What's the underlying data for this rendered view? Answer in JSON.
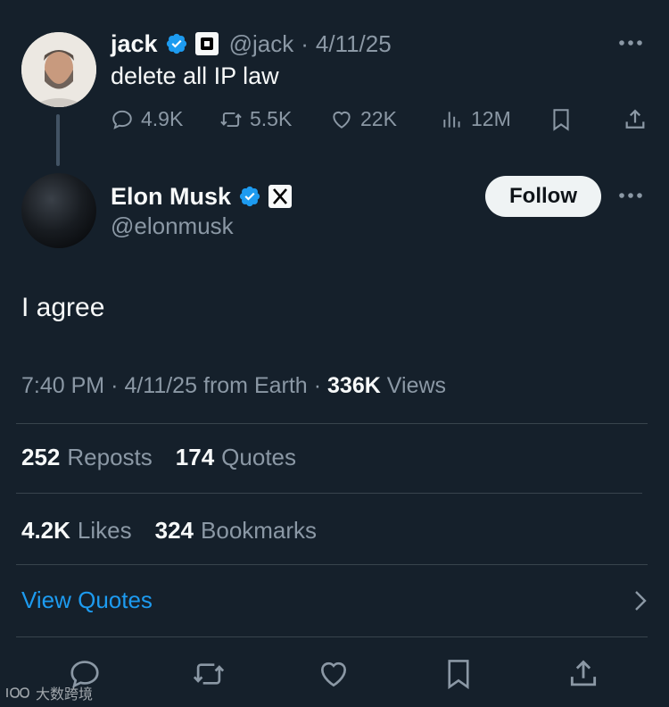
{
  "parent_tweet": {
    "name": "jack",
    "handle": "@jack",
    "separator": "·",
    "date": "4/11/25",
    "text": "delete all IP law",
    "actions": {
      "replies": "4.9K",
      "reposts": "5.5K",
      "likes": "22K",
      "views": "12M"
    }
  },
  "main_tweet": {
    "name": "Elon Musk",
    "handle": "@elonmusk",
    "follow_label": "Follow",
    "text": "I agree",
    "time": "7:40 PM",
    "date": "4/11/25",
    "location": "from Earth",
    "separator": "·",
    "views_count": "336K",
    "views_label": "Views",
    "reposts_count": "252",
    "reposts_label": "Reposts",
    "quotes_count": "174",
    "quotes_label": "Quotes",
    "likes_count": "4.2K",
    "likes_label": "Likes",
    "bookmarks_count": "324",
    "bookmarks_label": "Bookmarks",
    "view_quotes_label": "View Quotes"
  },
  "watermark": "大数跨境",
  "colors": {
    "background": "#15202b",
    "text_primary": "#f7f9f9",
    "text_secondary": "#8b98a5",
    "accent_blue": "#1d9bf0",
    "divider": "#38444d"
  }
}
